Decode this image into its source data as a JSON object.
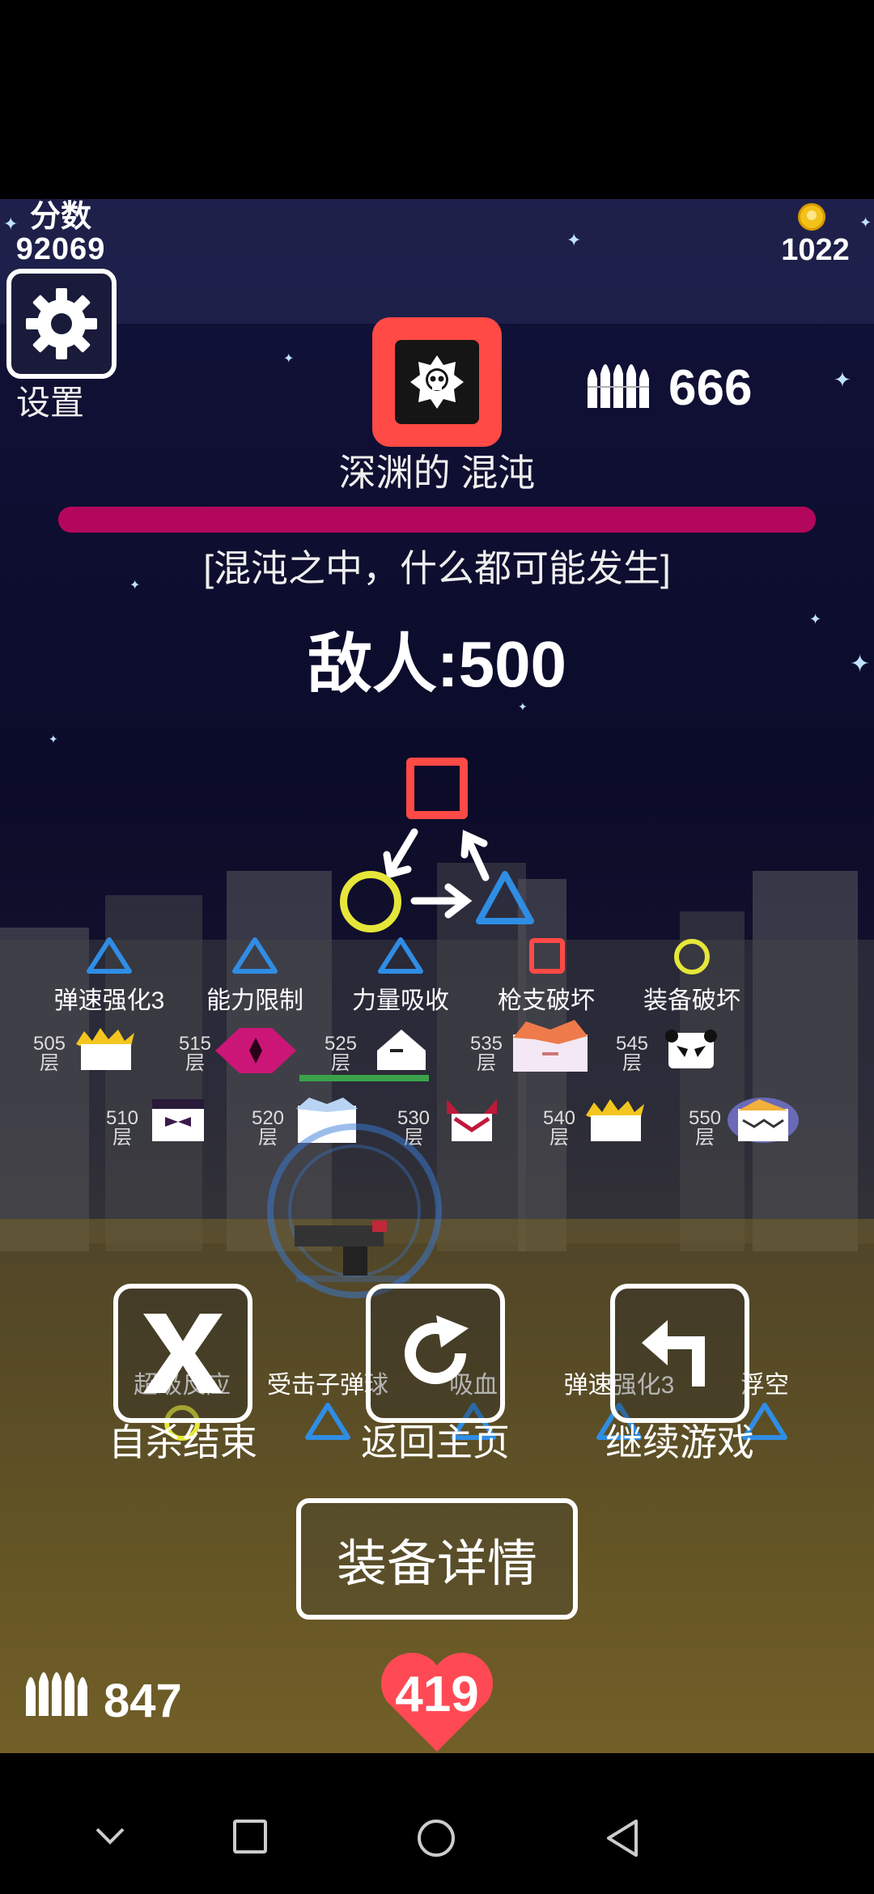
{
  "hud": {
    "score_label": "分数",
    "score_value": "92069",
    "coins": "1022",
    "settings_label": "设置",
    "ammo_top": "666",
    "ammo_bottom": "847",
    "health": "419"
  },
  "boss": {
    "name": "深渊的 混沌",
    "tagline": "[混沌之中，什么都可能发生]",
    "enemies": "敌人:500",
    "hp_fraction": 1.0
  },
  "skills_top": [
    {
      "label": "弹速强化3",
      "shape": "triangle"
    },
    {
      "label": "能力限制",
      "shape": "triangle"
    },
    {
      "label": "力量吸收",
      "shape": "triangle"
    },
    {
      "label": "枪支破坏",
      "shape": "square"
    },
    {
      "label": "装备破坏",
      "shape": "circle"
    }
  ],
  "floors_row1": [
    "505",
    "515",
    "525",
    "535",
    "545"
  ],
  "floors_row2": [
    "510",
    "520",
    "530",
    "540",
    "550"
  ],
  "floor_suffix": "层",
  "skills_bottom": [
    {
      "label": "超级反应",
      "shape": "circle"
    },
    {
      "label": "受击子弹球",
      "shape": "triangle"
    },
    {
      "label": "吸血",
      "shape": "triangle"
    },
    {
      "label": "弹速强化3",
      "shape": "triangle"
    },
    {
      "label": "浮空",
      "shape": "triangle"
    }
  ],
  "menu": {
    "suicide": "自杀结束",
    "home": "返回主页",
    "continue": "继续游戏",
    "equipment": "装备详情"
  },
  "colors": {
    "red": "#ff4a45",
    "yellow": "#e6e63a",
    "blue": "#2f8de4",
    "hp_bar": "#b3075b"
  }
}
